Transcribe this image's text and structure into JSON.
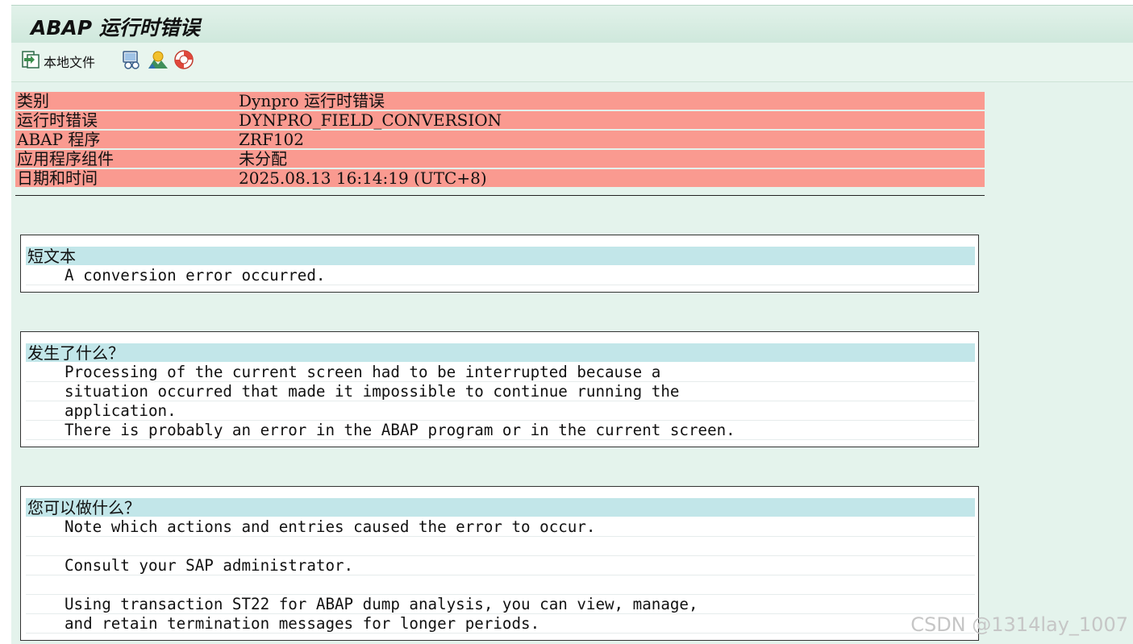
{
  "window": {
    "title": "ABAP 运行时错误"
  },
  "toolbar": {
    "local_file_label": "本地文件"
  },
  "header_table": [
    {
      "key": "类别",
      "value": "Dynpro 运行时错误"
    },
    {
      "key": "运行时错误",
      "value": "DYNPRO_FIELD_CONVERSION"
    },
    {
      "key": "ABAP 程序",
      "value": "ZRF102"
    },
    {
      "key": "应用程序组件",
      "value": "未分配"
    },
    {
      "key": "日期和时间",
      "value": "2025.08.13 16:14:19 (UTC+8)"
    }
  ],
  "sections": [
    {
      "heading": "短文本",
      "lines": [
        "A conversion error occurred."
      ]
    },
    {
      "heading": "发生了什么？",
      "lines": [
        "Processing of the current screen had to be interrupted because a",
        "situation occurred that made it impossible to continue running the",
        "application.",
        "There is probably an error in the ABAP program or in the current screen."
      ]
    },
    {
      "heading": "您可以做什么？",
      "lines": [
        "Note which actions and entries caused the error to occur.",
        "",
        "Consult your SAP administrator.",
        "",
        "Using transaction ST22 for ABAP dump analysis, you can view, manage,",
        "and retain termination messages for longer periods."
      ]
    }
  ],
  "watermark": "CSDN @1314lay_1007",
  "colors": {
    "header_row_bg": "#fa9a90",
    "section_heading_bg": "#c2e6e9",
    "content_bg": "#e4f3ec",
    "titlebar_bg": "#d8eee2"
  }
}
